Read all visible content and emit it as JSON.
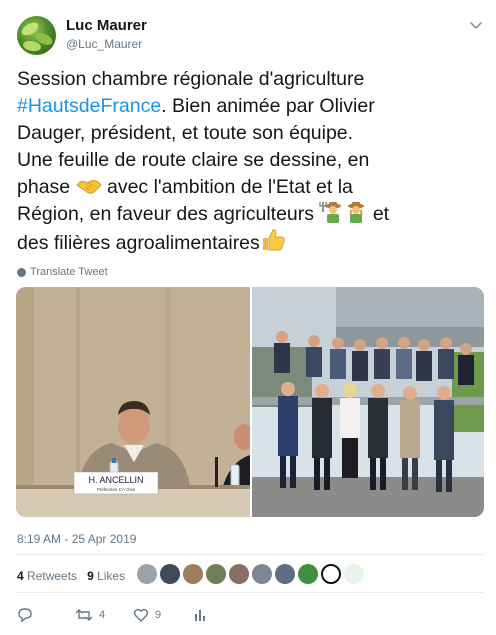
{
  "author": {
    "name": "Luc Maurer",
    "handle": "@Luc_Maurer"
  },
  "tweet": {
    "line1": "Session chambre régionale d'agriculture",
    "hashtag": "#HautsdeFrance",
    "line2_rest": ". Bien animée par Olivier",
    "line3": "Dauger, président, et toute son équipe.",
    "line4": "Une feuille de route claire se dessine, en",
    "line5_a": "phase ",
    "line5_b": " avec l'ambition de l'Etat et la",
    "line6_a": "Région, en faveur des agriculteurs ",
    "line6_b": " et",
    "line7": "des filières agroalimentaires"
  },
  "translate_label": "Translate Tweet",
  "photo_nameplate": "H. ANCELLIN",
  "photo_nameplate_sub": "Préfecture CA Oise",
  "timestamp": "8:19 AM - 25 Apr 2019",
  "stats": {
    "retweets_count": "4",
    "retweets_label": "Retweets",
    "likes_count": "9",
    "likes_label": "Likes"
  },
  "actions": {
    "retweet_count": "4",
    "like_count": "9"
  },
  "colors": {
    "accent": "#1b95e0",
    "muted": "#657786",
    "text": "#14171a",
    "like_heart": "#e0245e"
  },
  "icons": [
    "chevron-down-icon",
    "globe-icon",
    "reply-icon",
    "retweet-icon",
    "heart-icon",
    "analytics-icon",
    "handshake-emoji",
    "farmer-emoji",
    "thumbs-up-emoji"
  ]
}
